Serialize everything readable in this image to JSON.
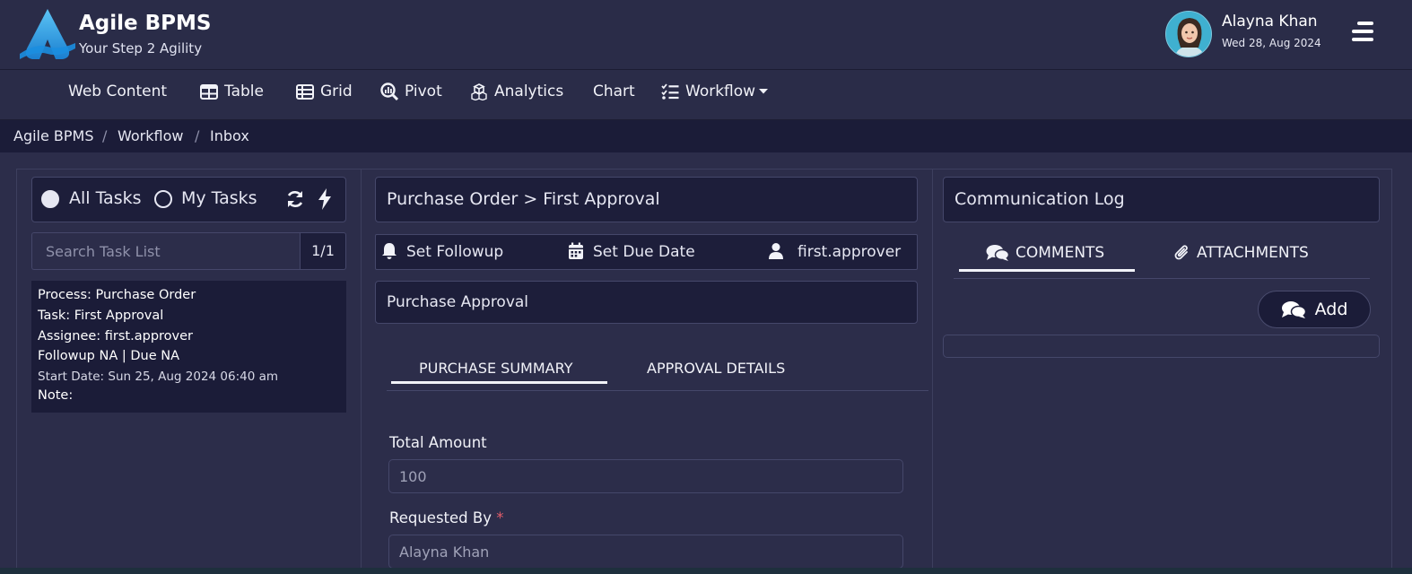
{
  "header": {
    "app_title": "Agile BPMS",
    "app_subtitle": "Your Step 2 Agility",
    "user_name": "Alayna Khan",
    "user_date": "Wed 28, Aug 2024"
  },
  "nav": {
    "items": [
      {
        "label": "Web Content",
        "icon": "none"
      },
      {
        "label": "Table",
        "icon": "table-icon"
      },
      {
        "label": "Grid",
        "icon": "grid-list-icon"
      },
      {
        "label": "Pivot",
        "icon": "magnify-chart-icon"
      },
      {
        "label": "Analytics",
        "icon": "cubes-icon"
      },
      {
        "label": "Chart",
        "icon": "none"
      },
      {
        "label": "Workflow",
        "icon": "checklist-icon",
        "dropdown": true
      }
    ]
  },
  "breadcrumb": [
    "Agile BPMS",
    "Workflow",
    "Inbox"
  ],
  "task_panel": {
    "filter_all": "All Tasks",
    "filter_mine": "My Tasks",
    "selected_filter": "All Tasks",
    "search_placeholder": "Search Task List",
    "counter": "1/1",
    "task": {
      "process": "Process: Purchase Order",
      "task": "Task: First Approval",
      "assignee": "Assignee: first.approver",
      "followup_due": "Followup NA | Due NA",
      "start_date": "Start Date: Sun 25, Aug 2024 06:40 am",
      "note": "Note:"
    }
  },
  "detail_panel": {
    "title": "Purchase Order > First Approval",
    "set_followup": "Set Followup",
    "set_due_date": "Set Due Date",
    "assignee": "first.approver",
    "form_title": "Purchase Approval",
    "tabs": [
      "PURCHASE SUMMARY",
      "APPROVAL DETAILS"
    ],
    "active_tab": "PURCHASE SUMMARY",
    "fields": [
      {
        "label": "Total Amount",
        "value": "100",
        "required": false
      },
      {
        "label": "Requested By",
        "value": "Alayna Khan",
        "required": true,
        "required_mark": "*"
      }
    ]
  },
  "comm_panel": {
    "title": "Communication Log",
    "tabs": [
      "COMMENTS",
      "ATTACHMENTS"
    ],
    "active_tab": "COMMENTS",
    "add_label": "Add"
  },
  "colors": {
    "header_bg": "#2a2c48",
    "breadcrumb_bg": "#1b1c38",
    "panel_bg": "#1d1e3a",
    "page_bg": "#2c2d4a",
    "logo_blue": "#2aa3ea",
    "required": "#e35d6a"
  }
}
